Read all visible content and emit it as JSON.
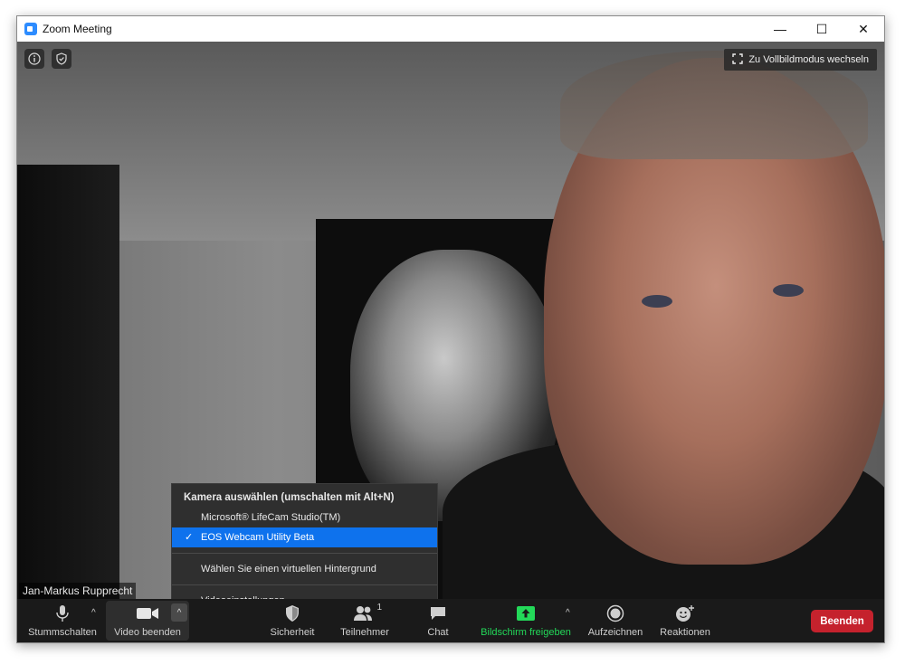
{
  "window": {
    "title": "Zoom Meeting",
    "controls": {
      "minimize": "—",
      "maximize": "☐",
      "close": "✕"
    }
  },
  "video": {
    "fullscreen_label": "Zu Vollbildmodus wechseln",
    "participant_name": "Jan-Markus Rupprecht",
    "info_icon": "info-icon",
    "security_icon": "shield-icon"
  },
  "camera_menu": {
    "header": "Kamera auswählen (umschalten mit Alt+N)",
    "cameras": [
      {
        "label": "Microsoft® LifeCam Studio(TM)",
        "selected": false
      },
      {
        "label": "EOS Webcam Utility Beta",
        "selected": true
      }
    ],
    "check_mark": "✓",
    "virtual_background": "Wählen Sie einen virtuellen Hintergrund",
    "video_settings": "Videoeinstellungen..."
  },
  "toolbar": {
    "mute_label": "Stummschalten",
    "video_label": "Video beenden",
    "security_label": "Sicherheit",
    "participants_label": "Teilnehmer",
    "participants_count": "1",
    "chat_label": "Chat",
    "share_label": "Bildschirm freigeben",
    "record_label": "Aufzeichnen",
    "reactions_label": "Reaktionen",
    "end_label": "Beenden",
    "caret": "^"
  },
  "colors": {
    "accent_blue": "#0e72ed",
    "share_green": "#23d959",
    "end_red": "#c5222d"
  }
}
